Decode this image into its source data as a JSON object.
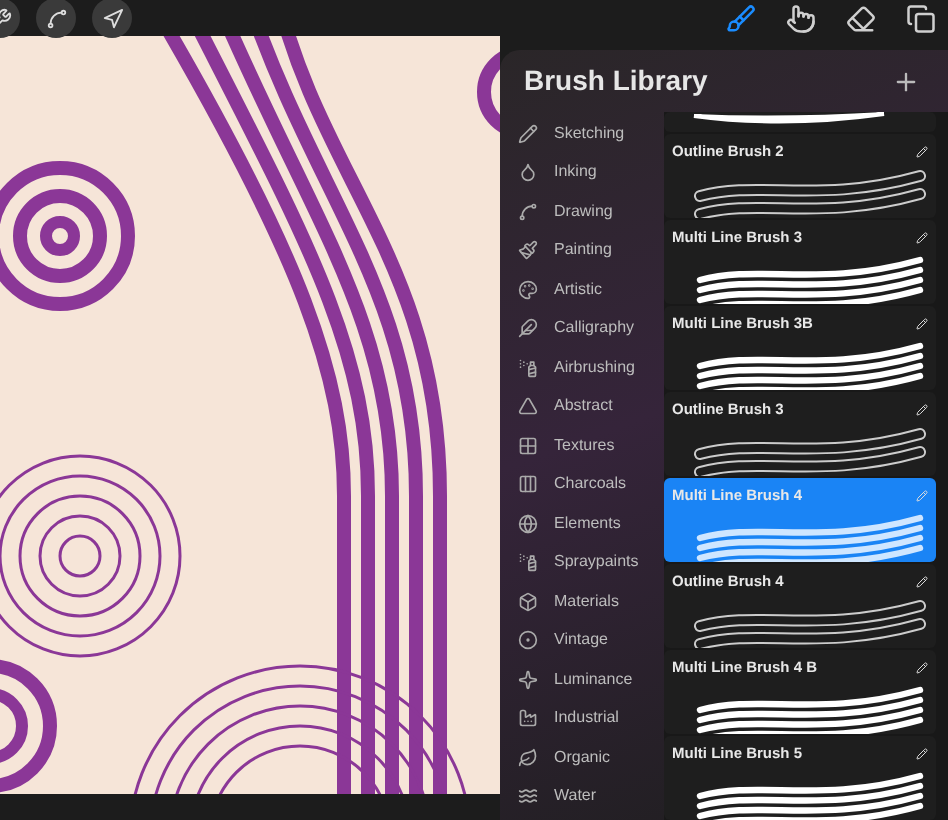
{
  "toolbar": {
    "left_tools": [
      {
        "kind": "wrench"
      },
      {
        "kind": "selection"
      },
      {
        "kind": "transform"
      }
    ],
    "right_tools": [
      {
        "kind": "brush",
        "selected": true
      },
      {
        "kind": "smudge",
        "selected": false
      },
      {
        "kind": "eraser",
        "selected": false
      },
      {
        "kind": "layers",
        "selected": false
      }
    ]
  },
  "brush_library": {
    "title": "Brush Library",
    "categories": [
      {
        "label": "Sketching"
      },
      {
        "label": "Inking"
      },
      {
        "label": "Drawing"
      },
      {
        "label": "Painting"
      },
      {
        "label": "Artistic"
      },
      {
        "label": "Calligraphy"
      },
      {
        "label": "Airbrushing"
      },
      {
        "label": "Abstract"
      },
      {
        "label": "Textures"
      },
      {
        "label": "Charcoals"
      },
      {
        "label": "Elements"
      },
      {
        "label": "Spraypaints"
      },
      {
        "label": "Materials"
      },
      {
        "label": "Vintage"
      },
      {
        "label": "Luminance"
      },
      {
        "label": "Industrial"
      },
      {
        "label": "Organic"
      },
      {
        "label": "Water"
      }
    ],
    "brushes": [
      {
        "kind": "taper",
        "selected": false
      },
      {
        "name": "Outline Brush 2",
        "kind": "outline",
        "selected": false
      },
      {
        "name": "Multi Line Brush 3",
        "kind": "multi",
        "selected": false
      },
      {
        "name": "Multi Line Brush 3B",
        "kind": "multi",
        "selected": false
      },
      {
        "name": "Outline Brush 3",
        "kind": "outline",
        "selected": false
      },
      {
        "name": "Multi Line Brush 4",
        "kind": "multi",
        "selected": true
      },
      {
        "name": "Outline Brush 4",
        "kind": "outline",
        "selected": false
      },
      {
        "name": "Multi Line Brush 4 B",
        "kind": "multi",
        "selected": false
      },
      {
        "name": "Multi Line Brush 5",
        "kind": "multi",
        "selected": false
      }
    ]
  }
}
